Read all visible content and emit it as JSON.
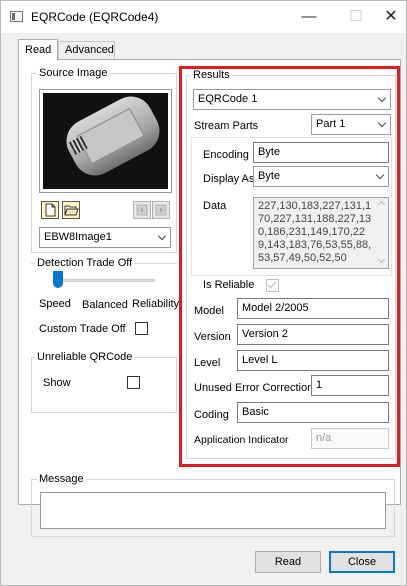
{
  "window": {
    "title": "EQRCode (EQRCode4)",
    "minimize_glyph": "—",
    "maximize_glyph": "☐",
    "close_glyph": "✕"
  },
  "tabs": [
    {
      "label": "Read",
      "active": true
    },
    {
      "label": "Advanced",
      "active": false
    }
  ],
  "source_image": {
    "group_label": "Source Image",
    "tools": [
      "new-file-icon",
      "open-folder-icon",
      "prev-image-icon",
      "next-image-icon"
    ],
    "image_combo": "EBW8Image1"
  },
  "trade_off": {
    "group_label": "Detection Trade Off",
    "slider_level": "Speed",
    "labels": [
      "Speed",
      "Balanced",
      "Reliability"
    ],
    "custom_label": "Custom Trade Off",
    "custom_checked": false
  },
  "unreliable": {
    "group_label": "Unreliable QRCode",
    "show_label": "Show",
    "show_checked": false
  },
  "results": {
    "group_label": "Results",
    "selected": "EQRCode 1",
    "stream_parts_label": "Stream Parts",
    "stream_part": "Part 1",
    "encoding_label": "Encoding",
    "encoding": "Byte",
    "display_as_label": "Display As",
    "display_as": "Byte",
    "data_label": "Data",
    "data": "227,130,183,227,131,170,227,131,188,227,130,186,231,149,170,229,143,183,76,53,55,88,53,57,49,50,52,50",
    "is_reliable_label": "Is Reliable",
    "is_reliable": true,
    "model_label": "Model",
    "model": "Model 2/2005",
    "version_label": "Version",
    "version": "Version 2",
    "level_label": "Level",
    "level": "Level L",
    "unused_ec_label": "Unused Error Correction",
    "unused_ec": "1",
    "coding_label": "Coding",
    "coding": "Basic",
    "app_indicator_label": "Application Indicator",
    "app_indicator": "n/a"
  },
  "message": {
    "group_label": "Message",
    "text": ""
  },
  "buttons": {
    "read": "Read",
    "close": "Close"
  },
  "colors": {
    "highlight_frame": "#e11b22",
    "accent_blue": "#0078d7"
  }
}
